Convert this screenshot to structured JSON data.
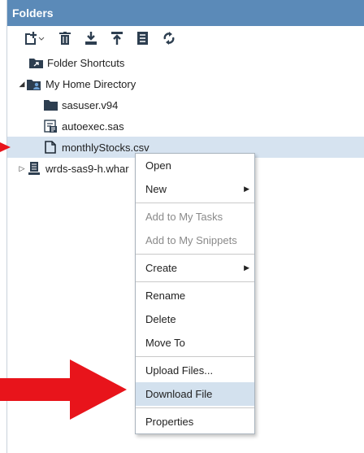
{
  "panel": {
    "title": "Folders"
  },
  "toolbar": {
    "buttons": [
      {
        "name": "new-item",
        "icon": "new-item-icon",
        "has_dropdown": true
      },
      {
        "name": "delete",
        "icon": "trash-icon"
      },
      {
        "name": "download",
        "icon": "download-icon"
      },
      {
        "name": "upload",
        "icon": "upload-icon"
      },
      {
        "name": "properties",
        "icon": "properties-icon"
      },
      {
        "name": "refresh",
        "icon": "refresh-icon"
      }
    ]
  },
  "tree": {
    "items": [
      {
        "label": "Folder Shortcuts",
        "icon": "folder-shortcut-icon"
      },
      {
        "label": "My Home Directory",
        "icon": "home-folder-icon",
        "expanded": true
      },
      {
        "label": "sasuser.v94",
        "icon": "folder-icon"
      },
      {
        "label": "autoexec.sas",
        "icon": "sas-program-icon"
      },
      {
        "label": "monthlyStocks.csv",
        "icon": "file-icon",
        "selected": true
      },
      {
        "label": "wrds-sas9-h.whar",
        "icon": "server-icon",
        "expanded": false
      }
    ]
  },
  "context_menu": {
    "items": [
      {
        "label": "Open"
      },
      {
        "label": "New",
        "submenu": true
      },
      {
        "label": "Add to My Tasks",
        "disabled": true
      },
      {
        "label": "Add to My Snippets",
        "disabled": true
      },
      {
        "label": "Create",
        "submenu": true
      },
      {
        "label": "Rename"
      },
      {
        "label": "Delete"
      },
      {
        "label": "Move To"
      },
      {
        "label": "Upload Files..."
      },
      {
        "label": "Download File",
        "highlighted": true
      },
      {
        "label": "Properties"
      }
    ]
  },
  "colors": {
    "title_bar": "#5b8ab8",
    "selection": "#d6e3f0",
    "annotation_arrow": "#e8141b",
    "icon_dark": "#2d3e50"
  }
}
